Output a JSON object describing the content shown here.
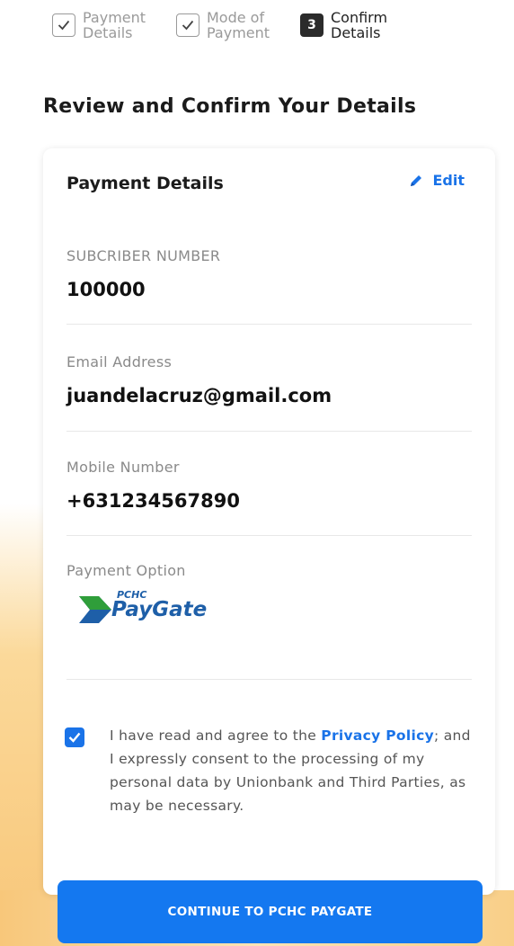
{
  "stepper": {
    "steps": [
      {
        "line1": "Payment",
        "line2": "Details",
        "number": "",
        "completed": true
      },
      {
        "line1": "Mode of",
        "line2": "Payment",
        "number": "",
        "completed": true
      },
      {
        "line1": "Confirm",
        "line2": "Details",
        "number": "3",
        "completed": false
      }
    ]
  },
  "page": {
    "title": "Review and Confirm Your Details"
  },
  "card": {
    "title": "Payment Details",
    "edit_label": "Edit",
    "fields": [
      {
        "label": "SUBCRIBER NUMBER",
        "value": "100000"
      },
      {
        "label": "Email Address",
        "value": "juandelacruz@gmail.com"
      },
      {
        "label": "Mobile Number",
        "value": "+631234567890"
      }
    ],
    "payment_option_label": "Payment Option",
    "payment_logo": {
      "small": "PCHC",
      "large": "PayGate"
    }
  },
  "consent": {
    "checked": true,
    "text_before": "I have read and agree to the ",
    "link": "Privacy Policy",
    "text_after": "; and I expressly consent to the processing of my personal data by Unionbank and Third Parties, as may be necessary."
  },
  "cta": {
    "label": "CONTINUE TO PCHC PAYGATE"
  },
  "colors": {
    "accent": "#1a73e8",
    "button": "#1478f0",
    "logo_blue": "#1e5fa8",
    "logo_green": "#2f9e3a"
  }
}
